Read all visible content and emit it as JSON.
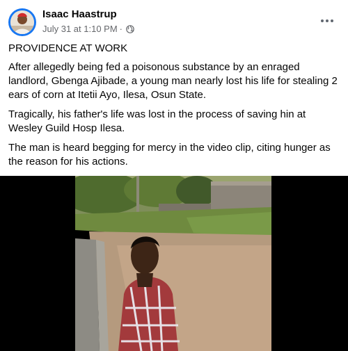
{
  "post": {
    "author": "Isaac Haastrup",
    "date": "July 31 at 1:10 PM",
    "separator": "·",
    "privacy_icon": "globe-icon",
    "more_icon": "more-options-icon",
    "paragraphs": [
      "PROVIDENCE AT WORK",
      "After allegedly being fed a poisonous substance by an enraged landlord, Gbenga Ajibade, a young man nearly lost his life for stealing 2 ears of corn at Itetii Ayo, Ilesa, Osun State.",
      "Tragically, his father's life was lost in the process of saving hin at Wesley Guild Hosp Ilesa.",
      "The man is heard begging for mercy in the video clip, citing hunger as the reason for his actions."
    ]
  },
  "colors": {
    "brand": "#1877f2",
    "meta_text": "#65676b",
    "video_bg": "#000000"
  }
}
